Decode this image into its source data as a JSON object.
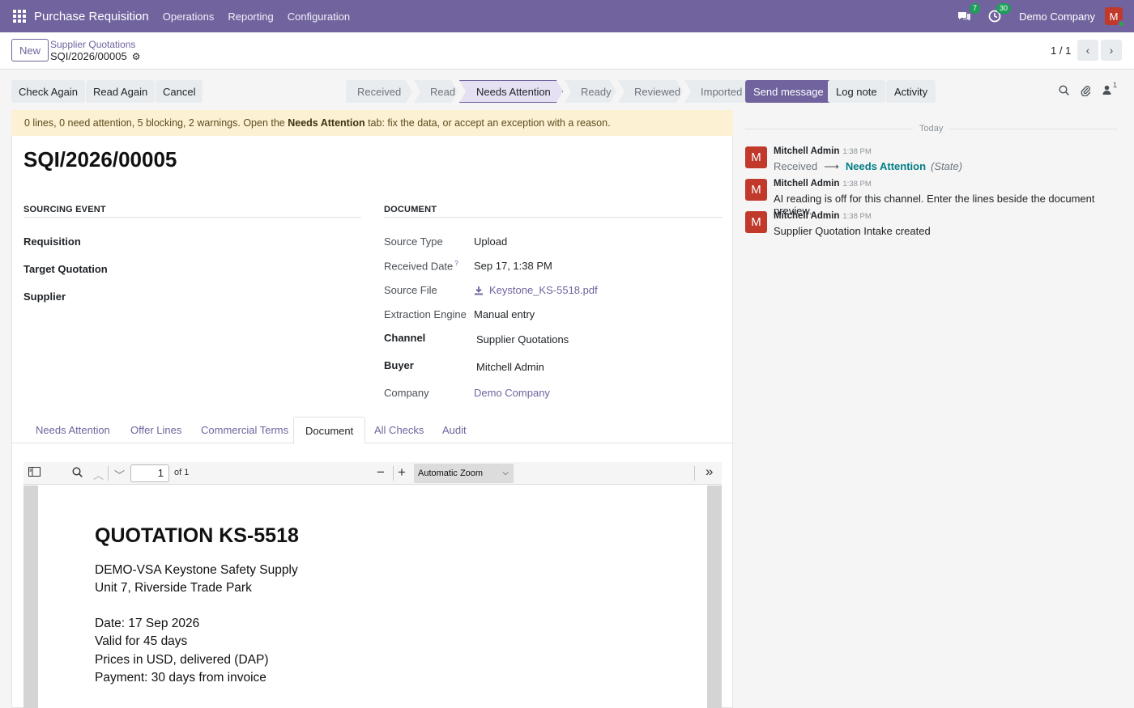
{
  "navbar": {
    "app_name": "Purchase Requisition",
    "menus": [
      "Operations",
      "Reporting",
      "Configuration"
    ],
    "messages_count": "7",
    "activities_count": "30",
    "company": "Demo Company",
    "user_initial": "M"
  },
  "control": {
    "new_label": "New",
    "breadcrumb_parent": "Supplier Quotations",
    "breadcrumb_current": "SQI/2026/00005",
    "pager": "1 / 1"
  },
  "actions": {
    "check_again": "Check Again",
    "read_again": "Read Again",
    "cancel": "Cancel"
  },
  "statusbar": {
    "stages": [
      "Received",
      "Read",
      "Needs Attention",
      "Ready",
      "Reviewed",
      "Imported"
    ],
    "active": "Needs Attention"
  },
  "alert": {
    "prefix": "0 lines, 0 need attention, 5 blocking, 2 warnings. Open the ",
    "bold": "Needs Attention",
    "suffix": " tab: fix the data, or accept an exception with a reason."
  },
  "record": {
    "title": "SQI/2026/00005",
    "sourcing_group": "Sourcing Event",
    "document_group": "Document",
    "sourcing_fields": {
      "requisition": "Requisition",
      "target_quotation": "Target Quotation",
      "supplier": "Supplier"
    },
    "document_fields": {
      "source_type_label": "Source Type",
      "source_type_value": "Upload",
      "received_date_label": "Received Date",
      "received_date_help": "?",
      "received_date_value": "Sep 17, 1:38 PM",
      "source_file_label": "Source File",
      "source_file_value": "Keystone_KS-5518.pdf",
      "extraction_engine_label": "Extraction Engine",
      "extraction_engine_value": "Manual entry",
      "channel_label": "Channel",
      "channel_value": "Supplier Quotations",
      "buyer_label": "Buyer",
      "buyer_value": "Mitchell Admin",
      "company_label": "Company",
      "company_value": "Demo Company"
    }
  },
  "tabs": [
    "Needs Attention",
    "Offer Lines",
    "Commercial Terms",
    "Document",
    "All Checks",
    "Audit"
  ],
  "active_tab": "Document",
  "pdf": {
    "page": "1",
    "of": "of 1",
    "zoom": "Automatic Zoom",
    "heading": "QUOTATION KS-5518",
    "lines": [
      "DEMO-VSA Keystone Safety Supply",
      "Unit 7, Riverside Trade Park",
      "Date: 17 Sep 2026",
      "Valid for 45 days",
      "Prices in USD, delivered (DAP)",
      "Payment: 30 days from invoice"
    ]
  },
  "chatter": {
    "send_message": "Send message",
    "log_note": "Log note",
    "activity": "Activity",
    "followers_count": "1",
    "date_separator": "Today",
    "messages": [
      {
        "author": "Mitchell Admin",
        "time": "1:38 PM",
        "old": "Received",
        "new": "Needs Attention",
        "field": "(State)"
      },
      {
        "author": "Mitchell Admin",
        "time": "1:38 PM",
        "body": "AI reading is off for this channel. Enter the lines beside the document preview."
      },
      {
        "author": "Mitchell Admin",
        "time": "1:38 PM",
        "body": "Supplier Quotation Intake created"
      }
    ],
    "avatar_initial": "M"
  }
}
